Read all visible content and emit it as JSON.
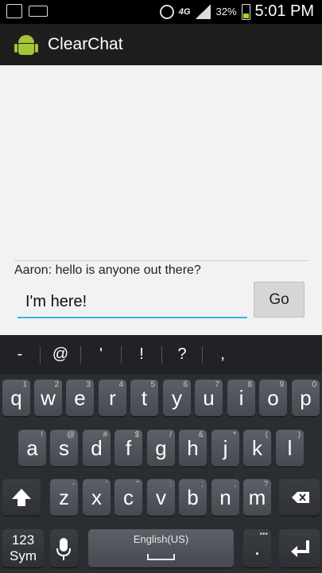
{
  "status_bar": {
    "battery": "32%",
    "network": "4G",
    "time": "5:01 PM"
  },
  "app": {
    "title": "ClearChat"
  },
  "chat": {
    "messages": [
      {
        "text": "Aaron: hello is anyone out there?"
      }
    ]
  },
  "composer": {
    "input_value": "I'm here!",
    "send_label": "Go"
  },
  "keyboard": {
    "suggestions": [
      "-",
      "@",
      "'",
      "!",
      "?",
      ","
    ],
    "row1": [
      {
        "key": "q",
        "hint": "1"
      },
      {
        "key": "w",
        "hint": "2"
      },
      {
        "key": "e",
        "hint": "3"
      },
      {
        "key": "r",
        "hint": "4"
      },
      {
        "key": "t",
        "hint": "5"
      },
      {
        "key": "y",
        "hint": "6"
      },
      {
        "key": "u",
        "hint": "7"
      },
      {
        "key": "i",
        "hint": "8"
      },
      {
        "key": "o",
        "hint": "9"
      },
      {
        "key": "p",
        "hint": "0"
      }
    ],
    "row2": [
      {
        "key": "a",
        "hint": "!"
      },
      {
        "key": "s",
        "hint": "@"
      },
      {
        "key": "d",
        "hint": "#"
      },
      {
        "key": "f",
        "hint": "$"
      },
      {
        "key": "g",
        "hint": "/"
      },
      {
        "key": "h",
        "hint": "&"
      },
      {
        "key": "j",
        "hint": "*"
      },
      {
        "key": "k",
        "hint": "("
      },
      {
        "key": "l",
        "hint": ")"
      }
    ],
    "row3": [
      {
        "key": "z",
        "hint": "-"
      },
      {
        "key": "x",
        "hint": "'"
      },
      {
        "key": "c",
        "hint": "\""
      },
      {
        "key": "v",
        "hint": ":"
      },
      {
        "key": "b",
        "hint": ";"
      },
      {
        "key": "n",
        "hint": ","
      },
      {
        "key": "m",
        "hint": "?"
      }
    ],
    "sym_label_top": "123",
    "sym_label_bottom": "Sym",
    "space_label": "English(US)",
    "period": "."
  }
}
